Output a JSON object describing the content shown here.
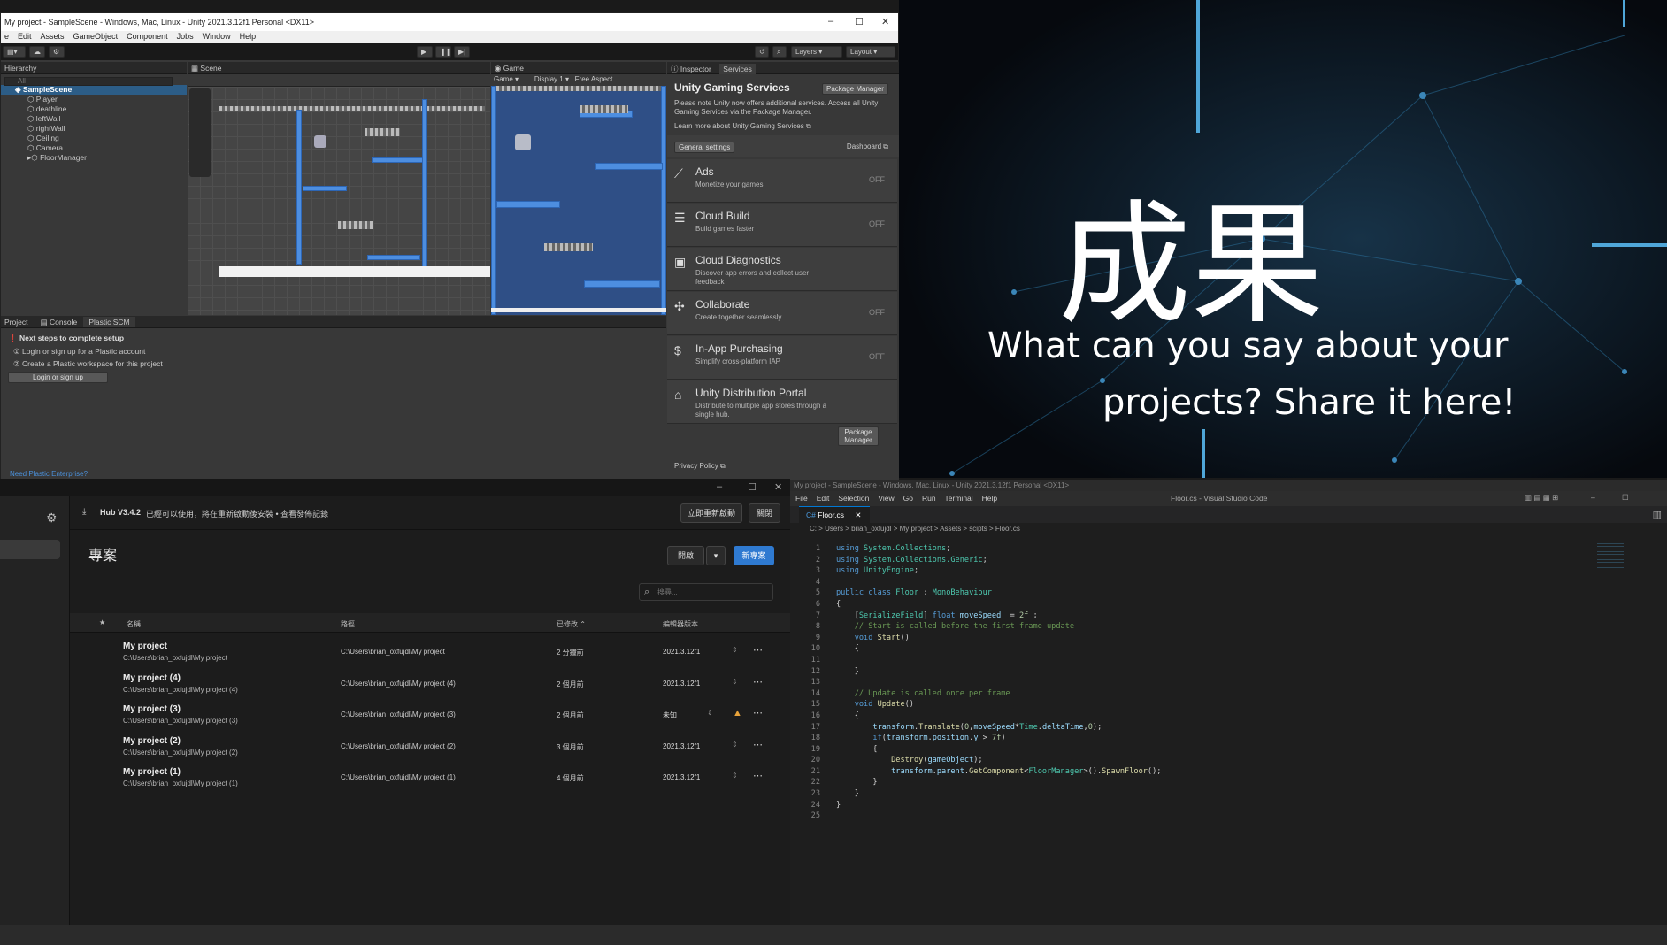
{
  "slide": {
    "heading": "成果",
    "subtitle_line1": "What can you say about your",
    "subtitle_line2": "projects? Share it here!"
  },
  "unity": {
    "title": "My project - SampleScene - Windows, Mac, Linux - Unity 2021.3.12f1 Personal <DX11>",
    "menu": [
      "e",
      "Edit",
      "Assets",
      "GameObject",
      "Component",
      "Jobs",
      "Window",
      "Help"
    ],
    "toolbar": {
      "layers": "Layers",
      "layout": "Layout"
    },
    "hierarchy": {
      "tab": "Hierarchy",
      "search_placeholder": "All",
      "root": "SampleScene",
      "items": [
        "Player",
        "deathline",
        "leftWall",
        "rightWall",
        "Ceiling",
        "Camera",
        "FloorManager"
      ]
    },
    "scene": {
      "tab": "Scene"
    },
    "game": {
      "tab": "Game",
      "mode": "Game",
      "display": "Display 1",
      "aspect": "Free Aspect"
    },
    "inspector": {
      "tabs": [
        "Inspector",
        "Services"
      ],
      "title": "Unity Gaming Services",
      "package_manager": "Package Manager",
      "notice": "Please note Unity now offers additional services. Access all Unity Gaming Services via the Package Manager.",
      "learn_more": "Learn more about Unity Gaming Services",
      "general_settings": "General settings",
      "dashboard": "Dashboard",
      "services": [
        {
          "name": "Ads",
          "desc": "Monetize your games",
          "state": "OFF",
          "icon": "megaphone-icon",
          "glyph": "⟋"
        },
        {
          "name": "Cloud Build",
          "desc": "Build games faster",
          "state": "OFF",
          "icon": "layers-icon",
          "glyph": "☰"
        },
        {
          "name": "Cloud Diagnostics",
          "desc": "Discover app errors and collect user feedback",
          "state": "",
          "icon": "clipboard-icon",
          "glyph": "▣"
        },
        {
          "name": "Collaborate",
          "desc": "Create together seamlessly",
          "state": "OFF",
          "icon": "collaborate-icon",
          "glyph": "✣"
        },
        {
          "name": "In-App Purchasing",
          "desc": "Simplify cross-platform IAP",
          "state": "OFF",
          "icon": "dollar-icon",
          "glyph": "$"
        },
        {
          "name": "Unity Distribution Portal",
          "desc": "Distribute to multiple app stores through a single hub.",
          "state": "",
          "icon": "store-icon",
          "glyph": "⌂"
        }
      ],
      "udp_button": "Package Manager",
      "privacy": "Privacy Policy"
    },
    "bottom": {
      "tabs": [
        "Project",
        "Console",
        "Plastic SCM"
      ],
      "next_steps": "Next steps to complete setup",
      "step1": "Login or sign up for a Plastic account",
      "step2": "Create a Plastic workspace for this project",
      "login_button": "Login or sign up",
      "enterprise": "Need Plastic Enterprise?"
    }
  },
  "hub": {
    "update_notice_version": "Hub V3.4.2",
    "update_notice": "已經可以使用，將在重新啟動後安裝 • 查看發佈記錄",
    "restart_button": "立即重新啟動",
    "close_button": "關閉",
    "heading": "專案",
    "open_button": "開啟",
    "new_button": "新專案",
    "search_placeholder": "搜尋...",
    "columns": {
      "name": "名稱",
      "path": "路徑",
      "modified": "已修改",
      "editor": "編輯器版本"
    },
    "projects": [
      {
        "name": "My project",
        "sub": "C:\\Users\\brian_oxfujdl\\My project",
        "path": "C:\\Users\\brian_oxfujdl\\My project",
        "modified": "2 分鐘前",
        "version": "2021.3.12f1",
        "warn": false
      },
      {
        "name": "My project (4)",
        "sub": "C:\\Users\\brian_oxfujdl\\My project (4)",
        "path": "C:\\Users\\brian_oxfujdl\\My project (4)",
        "modified": "2 個月前",
        "version": "2021.3.12f1",
        "warn": false
      },
      {
        "name": "My project (3)",
        "sub": "C:\\Users\\brian_oxfujdl\\My project (3)",
        "path": "C:\\Users\\brian_oxfujdl\\My project (3)",
        "modified": "2 個月前",
        "version": "未知",
        "warn": true
      },
      {
        "name": "My project (2)",
        "sub": "C:\\Users\\brian_oxfujdl\\My project (2)",
        "path": "C:\\Users\\brian_oxfujdl\\My project (2)",
        "modified": "3 個月前",
        "version": "2021.3.12f1",
        "warn": false
      },
      {
        "name": "My project (1)",
        "sub": "C:\\Users\\brian_oxfujdl\\My project (1)",
        "path": "C:\\Users\\brian_oxfujdl\\My project (1)",
        "modified": "4 個月前",
        "version": "2021.3.12f1",
        "warn": false
      }
    ]
  },
  "vscode": {
    "behind_title": "My project - SampleScene - Windows, Mac, Linux - Unity 2021.3.12f1 Personal <DX11>",
    "window_title": "Floor.cs - Visual Studio Code",
    "menu": [
      "File",
      "Edit",
      "Selection",
      "View",
      "Go",
      "Run",
      "Terminal",
      "Help"
    ],
    "tab": "Floor.cs",
    "breadcrumb": "C: > Users > brian_oxfujdl > My project > Assets > scipts > Floor.cs",
    "lines": [
      [
        [
          "kw",
          "using "
        ],
        [
          "ty",
          "System.Collections"
        ],
        [
          "tx",
          ";"
        ]
      ],
      [
        [
          "kw",
          "using "
        ],
        [
          "ty",
          "System.Collections.Generic"
        ],
        [
          "tx",
          ";"
        ]
      ],
      [
        [
          "kw",
          "using "
        ],
        [
          "ty",
          "UnityEngine"
        ],
        [
          "tx",
          ";"
        ]
      ],
      [],
      [
        [
          "kw",
          "public class "
        ],
        [
          "ty",
          "Floor"
        ],
        [
          "tx",
          " : "
        ],
        [
          "ty",
          "MonoBehaviour"
        ]
      ],
      [
        [
          "tx",
          "{"
        ]
      ],
      [
        [
          "tx",
          "    ["
        ],
        [
          "ty",
          "SerializeField"
        ],
        [
          "tx",
          "] "
        ],
        [
          "kw",
          "float "
        ],
        [
          "vr",
          "moveSpeed"
        ],
        [
          "tx",
          "  = "
        ],
        [
          "nm",
          "2f"
        ],
        [
          "tx",
          " ;"
        ]
      ],
      [
        [
          "cm",
          "    // Start is called before the first frame update"
        ]
      ],
      [
        [
          "kw",
          "    void "
        ],
        [
          "fn",
          "Start"
        ],
        [
          "tx",
          "()"
        ]
      ],
      [
        [
          "tx",
          "    {"
        ]
      ],
      [],
      [
        [
          "tx",
          "    }"
        ]
      ],
      [],
      [
        [
          "cm",
          "    // Update is called once per frame"
        ]
      ],
      [
        [
          "kw",
          "    void "
        ],
        [
          "fn",
          "Update"
        ],
        [
          "tx",
          "()"
        ]
      ],
      [
        [
          "tx",
          "    {"
        ]
      ],
      [
        [
          "tx",
          "        "
        ],
        [
          "vr",
          "transform"
        ],
        [
          "tx",
          "."
        ],
        [
          "fn",
          "Translate"
        ],
        [
          "tx",
          "("
        ],
        [
          "nm",
          "0"
        ],
        [
          "tx",
          ","
        ],
        [
          "vr",
          "moveSpeed"
        ],
        [
          "tx",
          "*"
        ],
        [
          "ty",
          "Time"
        ],
        [
          "tx",
          "."
        ],
        [
          "vr",
          "deltaTime"
        ],
        [
          "tx",
          ","
        ],
        [
          "nm",
          "0"
        ],
        [
          "tx",
          ");"
        ]
      ],
      [
        [
          "tx",
          "        "
        ],
        [
          "kw",
          "if"
        ],
        [
          "tx",
          "("
        ],
        [
          "vr",
          "transform"
        ],
        [
          "tx",
          "."
        ],
        [
          "vr",
          "position"
        ],
        [
          "tx",
          "."
        ],
        [
          "vr",
          "y"
        ],
        [
          "tx",
          " > "
        ],
        [
          "nm",
          "7f"
        ],
        [
          "tx",
          ")"
        ]
      ],
      [
        [
          "tx",
          "        {"
        ]
      ],
      [
        [
          "tx",
          "            "
        ],
        [
          "fn",
          "Destroy"
        ],
        [
          "tx",
          "("
        ],
        [
          "vr",
          "gameObject"
        ],
        [
          "tx",
          ");"
        ]
      ],
      [
        [
          "tx",
          "            "
        ],
        [
          "vr",
          "transform"
        ],
        [
          "tx",
          "."
        ],
        [
          "vr",
          "parent"
        ],
        [
          "tx",
          "."
        ],
        [
          "fn",
          "GetComponent"
        ],
        [
          "tx",
          "<"
        ],
        [
          "ty",
          "FloorManager"
        ],
        [
          "tx",
          ">()."
        ],
        [
          "fn",
          "SpawnFloor"
        ],
        [
          "tx",
          "();"
        ]
      ],
      [
        [
          "tx",
          "        }"
        ]
      ],
      [
        [
          "tx",
          "    }"
        ]
      ],
      [
        [
          "tx",
          "}"
        ]
      ],
      []
    ]
  }
}
